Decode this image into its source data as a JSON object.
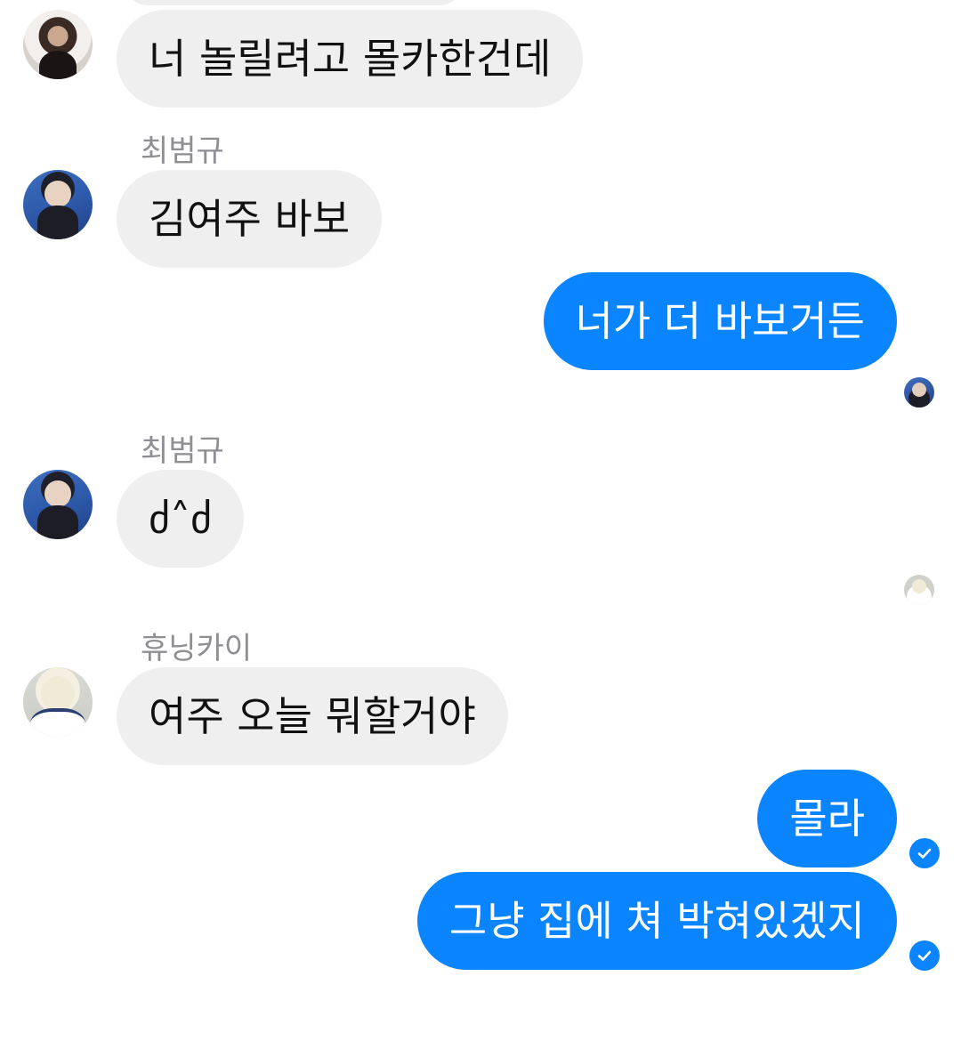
{
  "messages": [
    {
      "direction": "incoming",
      "avatar": "profile-photo-1",
      "text": "너 놀릴려고 몰카한건데"
    },
    {
      "direction": "incoming",
      "sender": "최범규",
      "avatar": "profile-photo-2",
      "text": "김여주 바보"
    },
    {
      "direction": "outgoing",
      "text": "너가 더 바보거든",
      "read_by_avatar": "profile-photo-2"
    },
    {
      "direction": "incoming",
      "sender": "최범규",
      "avatar": "profile-photo-2",
      "text": "ძ˄ძ",
      "read_by_avatar_after": "profile-photo-3"
    },
    {
      "direction": "incoming",
      "sender": "휴닝카이",
      "avatar": "profile-photo-3",
      "text": "여주 오늘 뭐할거야"
    },
    {
      "direction": "outgoing",
      "text": "몰라",
      "status": "delivered-check-icon"
    },
    {
      "direction": "outgoing",
      "text": "그냥 집에 쳐 박혀있겠지",
      "status": "delivered-check-icon"
    }
  ],
  "colors": {
    "outgoing_bubble": "#0a84ff",
    "incoming_bubble": "#efefef",
    "sender_name": "#8e8e93"
  }
}
